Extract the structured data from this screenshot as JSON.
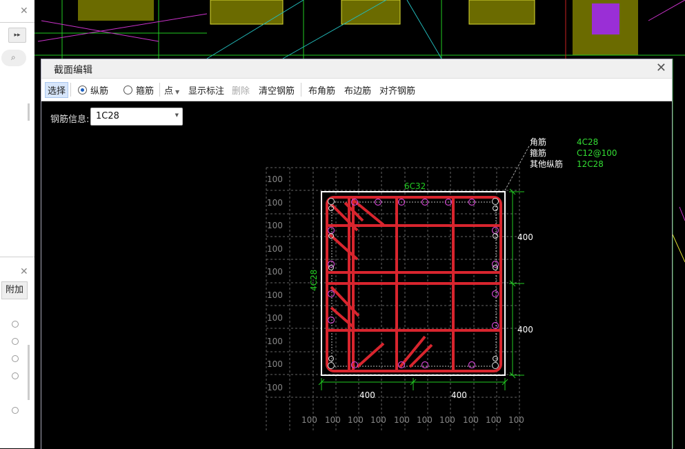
{
  "dialog": {
    "title": "截面编辑",
    "close_glyph": "✕"
  },
  "toolbar": {
    "select": "选择",
    "longitudinal": "纵筋",
    "stirrup": "箍筋",
    "point": "点",
    "show_dims": "显示标注",
    "delete": "删除",
    "clear_rebar": "清空钢筋",
    "corner_rebar": "布角筋",
    "edge_rebar": "布边筋",
    "align_rebar": "对齐钢筋"
  },
  "rebar_info": {
    "label": "钢筋信息:",
    "value": "1C28"
  },
  "legend": {
    "corner_label": "角筋",
    "corner_value": "4C28",
    "stirrup_label": "箍筋",
    "stirrup_value": "C12@100",
    "other_label": "其他纵筋",
    "other_value": "12C28"
  },
  "section": {
    "top_rebar": "6C32",
    "left_rebar": "4C28",
    "right_dim_top": "400",
    "right_dim_bottom": "400",
    "bottom_dim_left": "400",
    "bottom_dim_right": "400",
    "grid_label": "100"
  },
  "left_panel": {
    "close_glyph": "✕",
    "expand_glyph": "▸▸",
    "search_icon": "search-icon",
    "tab_label": "附加"
  },
  "colors": {
    "rebar": "#d8252e",
    "stirrup_red": "#d8252e",
    "dim_green": "#22cc22",
    "legend_green": "#33dd33",
    "bar_magenta": "#cc44cc",
    "outline": "#ffffff"
  }
}
